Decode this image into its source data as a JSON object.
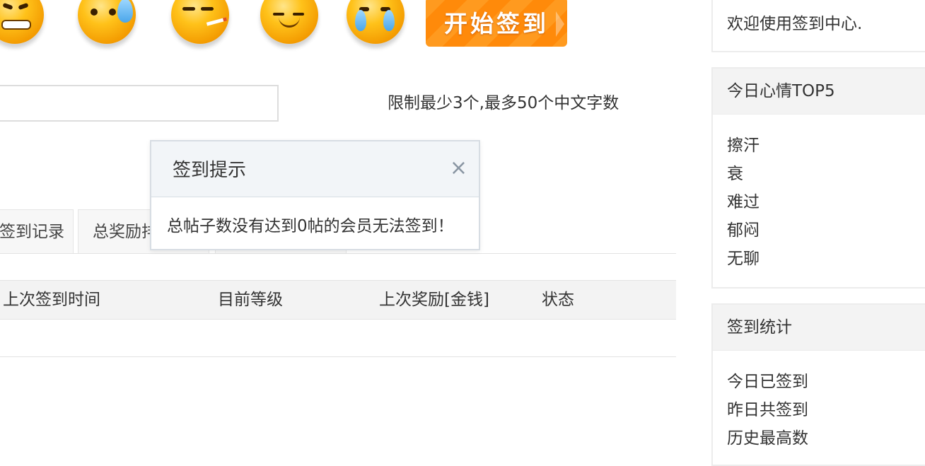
{
  "emoticons": [
    {
      "icon": "angry-grin-emoticon-icon"
    },
    {
      "icon": "sweat-emoticon-icon"
    },
    {
      "icon": "smoking-emoticon-icon"
    },
    {
      "icon": "bored-emoticon-icon"
    },
    {
      "icon": "crying-emoticon-icon"
    }
  ],
  "start_button": {
    "label": "开始签到"
  },
  "mood_input": {
    "value": "",
    "placeholder": ""
  },
  "limit_hint": "限制最少3个,最多50个中文字数",
  "tabs": [
    {
      "label": "签到记录"
    },
    {
      "label": "总奖励排"
    }
  ],
  "table": {
    "headers": [
      "上次签到时间",
      "目前等级",
      "上次奖励[金钱]",
      "状态"
    ]
  },
  "modal": {
    "title": "签到提示",
    "close": "×",
    "message": "总帖子数没有达到0帖的会员无法签到！"
  },
  "sidebar": {
    "welcome": "欢迎使用签到中心.",
    "mood_top": {
      "title": "今日心情TOP5",
      "items": [
        "擦汗",
        "衰",
        "难过",
        "郁闷",
        "无聊"
      ]
    },
    "stats": {
      "title": "签到统计",
      "items": [
        "今日已签到",
        "昨日共签到",
        "历史最高数"
      ]
    }
  },
  "colors": {
    "accent": "#ff8a0a",
    "modal_header": "#f2f5f8"
  }
}
